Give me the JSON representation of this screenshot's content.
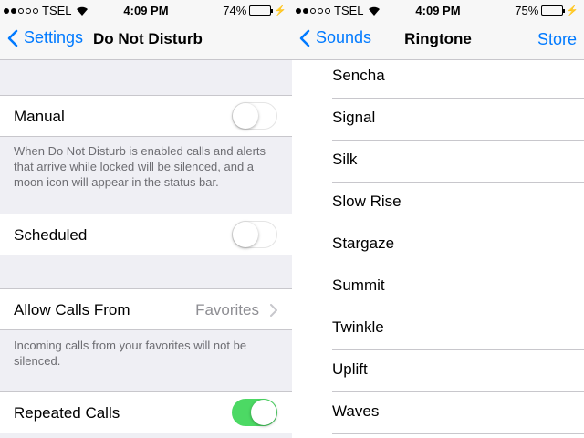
{
  "left_screen": {
    "status": {
      "carrier": "TSEL",
      "time": "4:09 PM",
      "battery": "74%",
      "battery_level": 0.74
    },
    "nav": {
      "back_label": "Settings",
      "title": "Do Not Disturb"
    },
    "manual": {
      "label": "Manual",
      "on": false
    },
    "manual_footer": "When Do Not Disturb is enabled calls and alerts that arrive while locked will be silenced, and a moon icon will appear in the status bar.",
    "scheduled": {
      "label": "Scheduled",
      "on": false
    },
    "allow_calls": {
      "label": "Allow Calls From",
      "value": "Favorites"
    },
    "allow_footer": "Incoming calls from your favorites will not be silenced.",
    "repeated": {
      "label": "Repeated Calls",
      "on": true
    }
  },
  "right_screen": {
    "status": {
      "carrier": "TSEL",
      "time": "4:09 PM",
      "battery": "75%",
      "battery_level": 0.75
    },
    "nav": {
      "back_label": "Sounds",
      "title": "Ringtone",
      "action_label": "Store"
    },
    "ringtones": [
      "Sencha",
      "Signal",
      "Silk",
      "Slow Rise",
      "Stargaze",
      "Summit",
      "Twinkle",
      "Uplift",
      "Waves"
    ]
  },
  "colors": {
    "accent": "#007aff",
    "toggle_on": "#4cd964",
    "group_bg": "#efeff4",
    "separator": "#c8c7cc",
    "secondary_text": "#6d6d72"
  },
  "icons": {
    "signal": "signal-dots-icon",
    "wifi": "wifi-icon",
    "battery": "battery-icon",
    "charging": "bolt-icon",
    "back": "chevron-left-icon",
    "disclosure": "chevron-right-icon"
  }
}
